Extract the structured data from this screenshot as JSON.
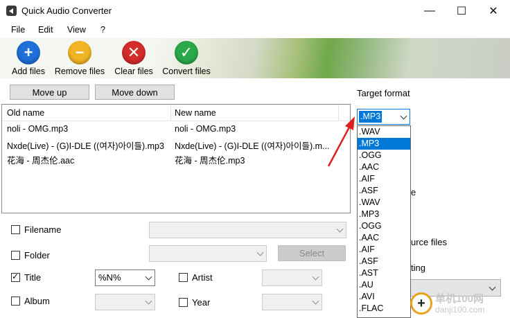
{
  "window": {
    "title": "Quick Audio Converter",
    "minimize": "—",
    "maximize": "☐",
    "close": "✕"
  },
  "menu": [
    "File",
    "Edit",
    "View",
    "?"
  ],
  "toolbar": {
    "add": {
      "label": "Add files",
      "icon": "plus-circle-icon",
      "color": "#1f6fd9"
    },
    "remove": {
      "label": "Remove files",
      "icon": "minus-circle-icon",
      "color": "#f0b424"
    },
    "clear": {
      "label": "Clear files",
      "icon": "x-circle-icon",
      "color": "#d42b2b"
    },
    "convert": {
      "label": "Convert files",
      "icon": "check-circle-icon",
      "color": "#2aa84a"
    }
  },
  "list_controls": {
    "move_up": "Move up",
    "move_down": "Move down"
  },
  "file_list": {
    "columns": [
      "Old name",
      "New name"
    ],
    "rows": [
      {
        "old": "noli - OMG.mp3",
        "new": "noli - OMG.mp3"
      },
      {
        "old": "Nxde(Live) - (G)I-DLE ((여자)아이들).mp3",
        "new": "Nxde(Live) - (G)I-DLE ((여자)아이들).m..."
      },
      {
        "old": "花海 - 周杰伦.aac",
        "new": "花海 - 周杰伦.mp3"
      }
    ]
  },
  "options": {
    "filename": {
      "label": "Filename",
      "checked": false
    },
    "folder": {
      "label": "Folder",
      "checked": false
    },
    "select_button": "Select",
    "title": {
      "label": "Title",
      "checked": true,
      "value": "%N%"
    },
    "artist": {
      "label": "Artist",
      "checked": false
    },
    "album": {
      "label": "Album",
      "checked": false
    },
    "year": {
      "label": "Year",
      "checked": false
    }
  },
  "target": {
    "label": "Target format",
    "selected": ".MP3",
    "options": [
      ".WAV",
      ".MP3",
      ".OGG",
      ".AAC",
      ".AIF",
      ".ASF",
      ".WAV",
      ".MP3",
      ".OGG",
      ".AAC",
      ".AIF",
      ".ASF",
      ".AST",
      ".AU",
      ".AVI",
      ".FLAC"
    ],
    "highlighted_index": 1
  },
  "side_partial": {
    "line1": "e",
    "line2": "urce files",
    "line3": "ting"
  },
  "watermark": {
    "symbol": "+",
    "line1": "单机100网",
    "line2": "danji100.com"
  }
}
